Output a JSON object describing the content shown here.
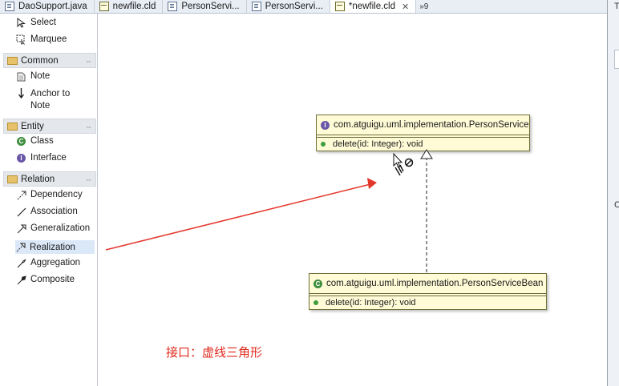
{
  "tabs": [
    {
      "label": "DaoSupport.java",
      "icon": "java-file-icon",
      "active": false
    },
    {
      "label": "newfile.cld",
      "icon": "class-diagram-icon",
      "active": false
    },
    {
      "label": "PersonServi...",
      "icon": "java-file-icon",
      "active": false
    },
    {
      "label": "PersonServi...",
      "icon": "java-file-icon",
      "active": false
    },
    {
      "label": "*newfile.cld",
      "icon": "class-diagram-icon",
      "active": true
    }
  ],
  "tab_overflow": "»9",
  "palette": {
    "tools": [
      {
        "label": "Select",
        "icon": "cursor-icon"
      },
      {
        "label": "Marquee",
        "icon": "marquee-icon"
      }
    ],
    "common": {
      "title": "Common",
      "items": [
        {
          "label": "Note",
          "icon": "note-icon"
        },
        {
          "label": "Anchor to Note",
          "line1": "Anchor to",
          "line2": "Note",
          "icon": "anchor-icon"
        }
      ]
    },
    "entity": {
      "title": "Entity",
      "items": [
        {
          "label": "Class",
          "icon": "class-icon"
        },
        {
          "label": "Interface",
          "icon": "interface-icon"
        }
      ]
    },
    "relation": {
      "title": "Relation",
      "items": [
        {
          "label": "Dependency",
          "icon": "dependency-icon"
        },
        {
          "label": "Association",
          "icon": "association-icon"
        },
        {
          "label": "Generalization",
          "icon": "generalization-icon"
        },
        {
          "label": "Realization",
          "icon": "realization-icon",
          "selected": true
        },
        {
          "label": "Aggregation",
          "icon": "aggregation-icon"
        },
        {
          "label": "Composite",
          "icon": "composite-icon"
        }
      ]
    }
  },
  "diagram": {
    "interface_box": {
      "name": "com.atguigu.uml.implementation.PersonService",
      "badge": "I",
      "operation": "delete(id: Integer): void"
    },
    "class_box": {
      "name": "com.atguigu.uml.implementation.PersonServiceBean",
      "badge": "C",
      "operation": "delete(id: Integer): void"
    }
  },
  "annotation": "接口：虚线三角形",
  "right_panel_letters": {
    "top": "T",
    "mid": "C"
  },
  "colors": {
    "annotation": "#e0291d",
    "uml_fill": "#fffbd6",
    "palette_selected": "#dbe8f8"
  }
}
